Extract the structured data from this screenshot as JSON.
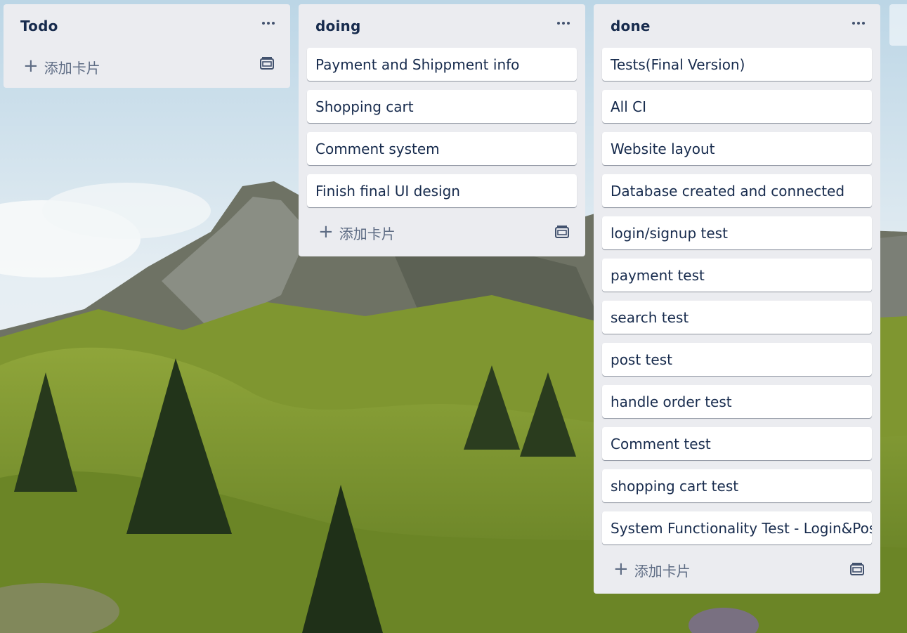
{
  "board": {
    "lists": [
      {
        "title": "Todo",
        "cards": [],
        "add_label": "添加卡片"
      },
      {
        "title": "doing",
        "cards": [
          "Payment and Shippment info",
          "Shopping cart",
          "Comment system",
          "Finish final UI design"
        ],
        "add_label": "添加卡片"
      },
      {
        "title": "done",
        "cards": [
          "Tests(Final Version)",
          "All CI",
          "Website layout",
          "Database created and connected",
          "login/signup test",
          "payment test",
          "search test",
          "post test",
          "handle order test",
          "Comment test",
          "shopping cart test",
          "System Functionality Test - Login&Post"
        ],
        "add_label": "添加卡片"
      }
    ]
  },
  "icons": {
    "list_menu": "more-horizontal-icon",
    "add": "plus-icon",
    "template": "card-template-icon"
  },
  "colors": {
    "list_bg": "#ebecf0",
    "card_bg": "#ffffff",
    "text": "#172b4d",
    "muted": "#5e6c84"
  }
}
